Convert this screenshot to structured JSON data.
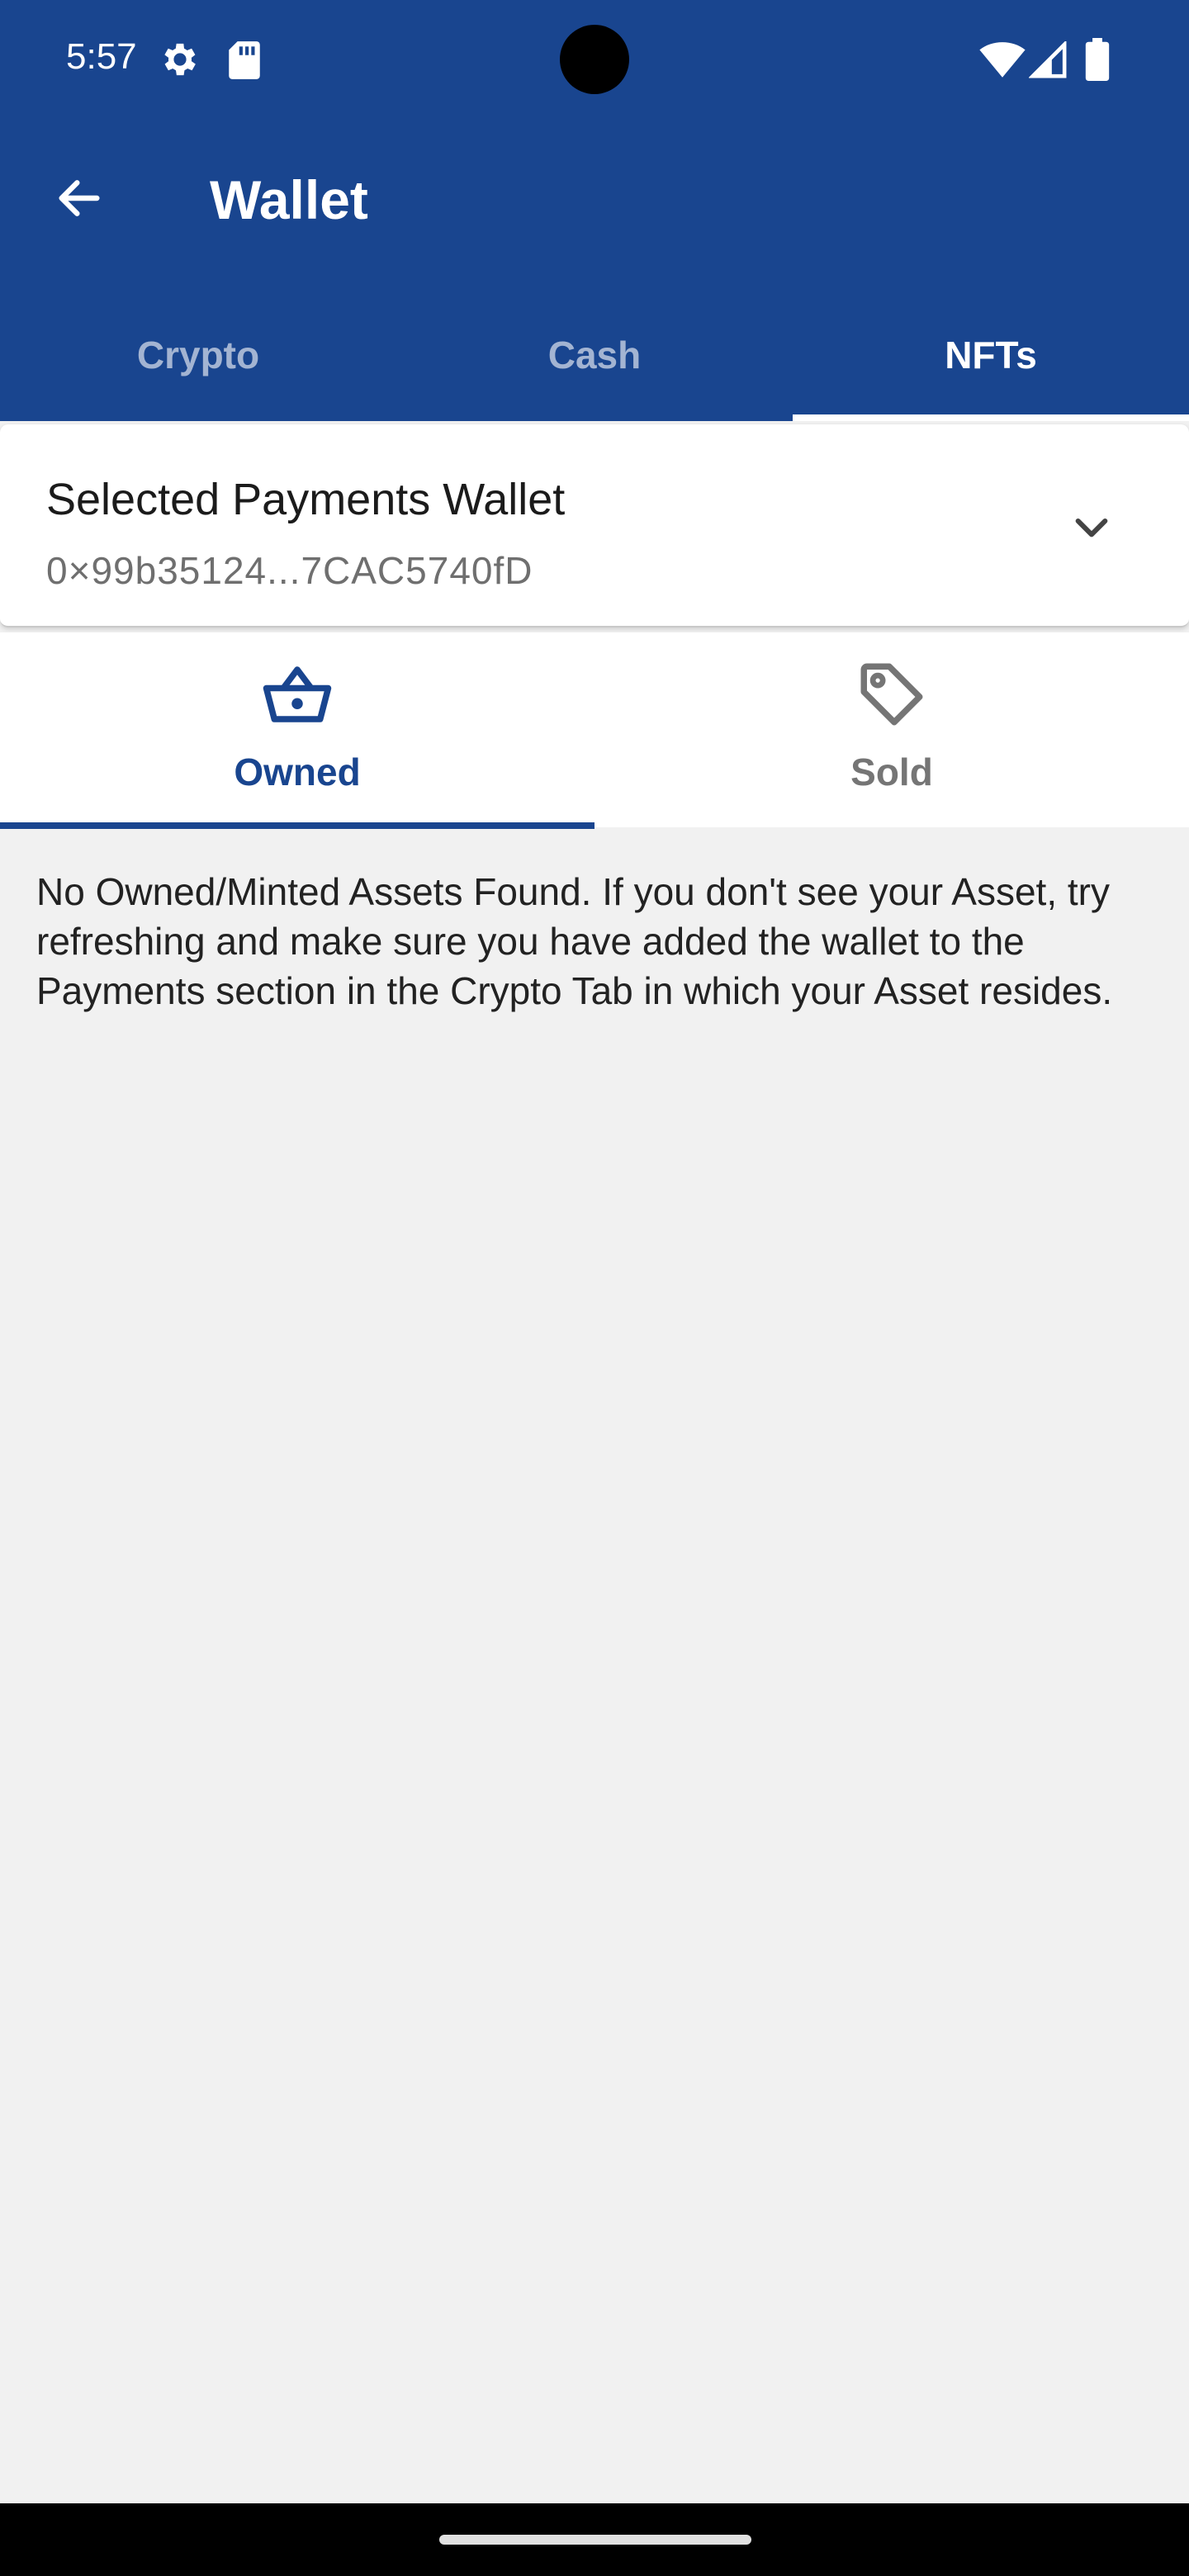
{
  "status_bar": {
    "time": "5:57",
    "icons": [
      "gear-icon",
      "sd-card-icon",
      "wifi-icon",
      "signal-icon",
      "battery-icon"
    ]
  },
  "header": {
    "title": "Wallet",
    "back_icon": "arrow-back-icon",
    "background_color": "#19458f"
  },
  "tabs": [
    {
      "label": "Crypto",
      "active": false
    },
    {
      "label": "Cash",
      "active": false
    },
    {
      "label": "NFTs",
      "active": true
    }
  ],
  "wallet_selector": {
    "title": "Selected Payments Wallet",
    "address": "0×99b35124...7CAC5740fD",
    "chevron_icon": "chevron-down-icon"
  },
  "sub_tabs": [
    {
      "label": "Owned",
      "icon": "basket-icon",
      "active": true
    },
    {
      "label": "Sold",
      "icon": "tag-icon",
      "active": false
    }
  ],
  "empty_message": "No Owned/Minted Assets Found. If you don't see your Asset, try refreshing and make sure you have added the wallet to the Payments section in the Crypto Tab in which your Asset resides.",
  "colors": {
    "accent": "#19458f",
    "background": "#f1f1f1",
    "inactive_label": "#757575"
  }
}
